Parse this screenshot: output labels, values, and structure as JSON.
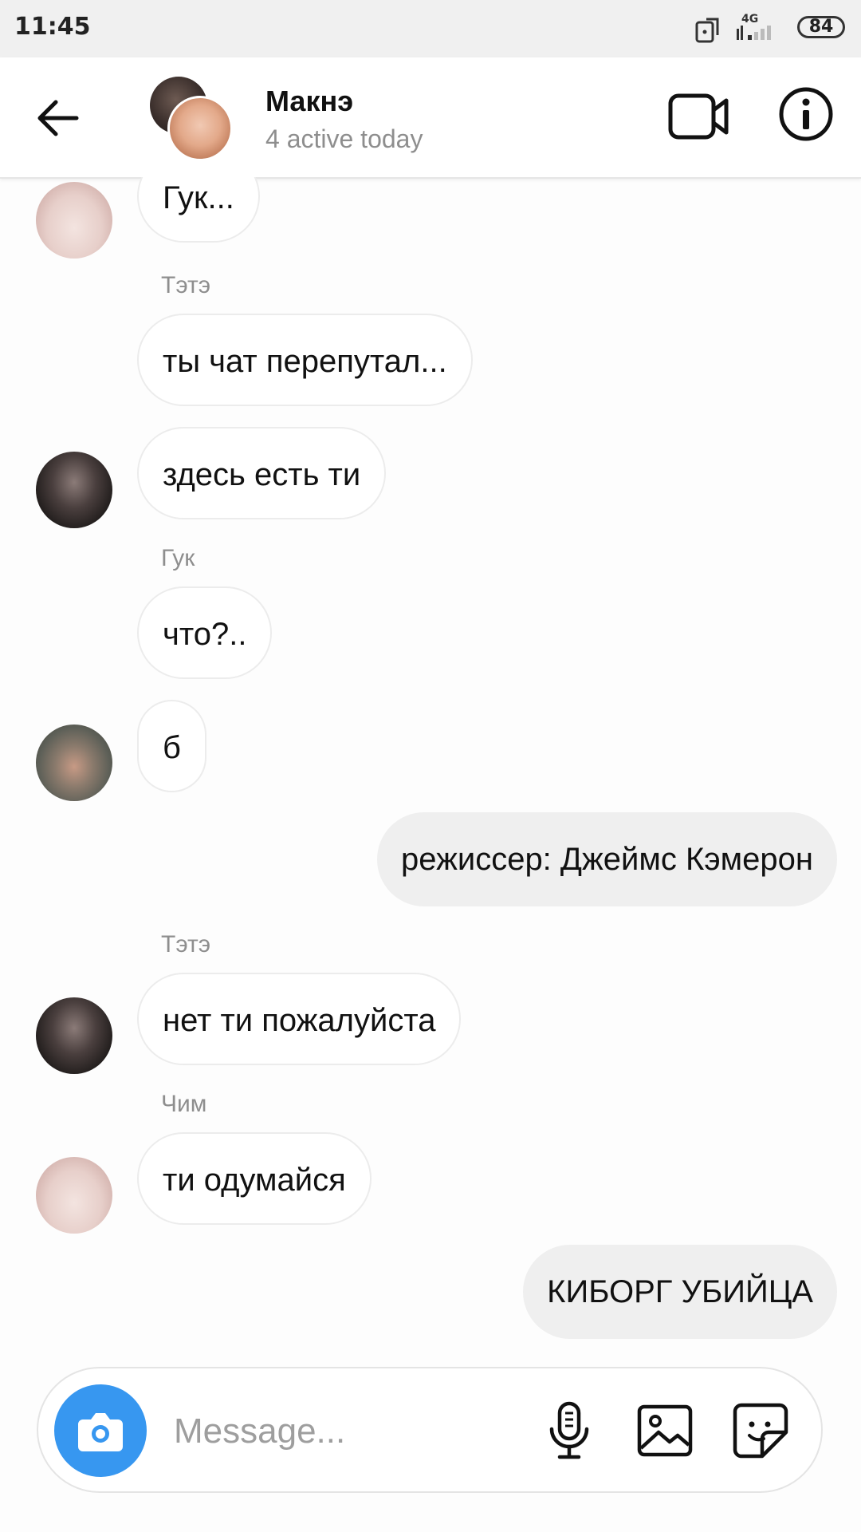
{
  "status_bar": {
    "time": "11:45",
    "network": "4G",
    "battery": "84"
  },
  "header": {
    "title": "Макнэ",
    "subtitle": "4 active today"
  },
  "messages": [
    {
      "type": "incoming",
      "text": "Гук..."
    },
    {
      "type": "sender",
      "text": "Тэтэ"
    },
    {
      "type": "incoming",
      "text": "ты чат перепутал..."
    },
    {
      "type": "incoming",
      "text": "здесь есть ти"
    },
    {
      "type": "sender",
      "text": "Гук"
    },
    {
      "type": "incoming",
      "text": "что?.."
    },
    {
      "type": "incoming",
      "text": "б"
    },
    {
      "type": "outgoing",
      "text": "режиссер: Джеймс Кэмерон"
    },
    {
      "type": "sender",
      "text": "Тэтэ"
    },
    {
      "type": "incoming",
      "text": "нет ти пожалуйста"
    },
    {
      "type": "sender",
      "text": "Чим"
    },
    {
      "type": "incoming",
      "text": "ти одумайся"
    },
    {
      "type": "outgoing",
      "text": "КИБОРГ УБИЙЦА"
    }
  ],
  "composer": {
    "placeholder": "Message..."
  },
  "icons": {
    "back": "arrow-left-icon",
    "video": "video-camera-icon",
    "info": "info-icon",
    "camera": "camera-icon",
    "mic": "microphone-icon",
    "gallery": "image-icon",
    "sticker": "sticker-icon"
  },
  "colors": {
    "accent": "#3797f0",
    "outgoing_bubble": "#efefef",
    "secondary_text": "#8e8e8e"
  }
}
